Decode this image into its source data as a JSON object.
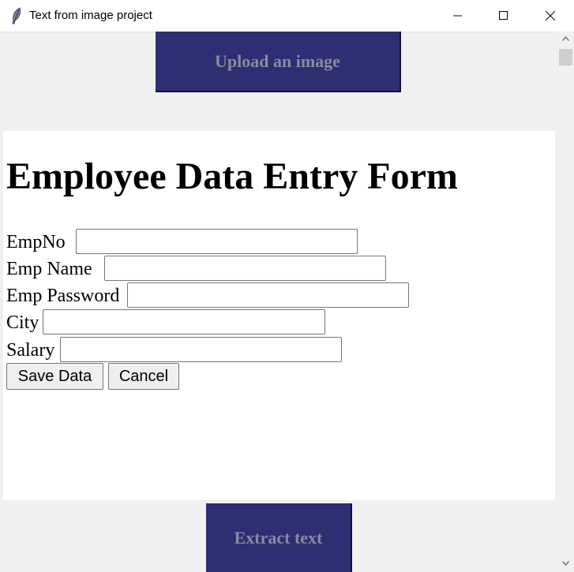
{
  "window": {
    "title": "Text from image project",
    "app_icon": "feather-icon",
    "controls": [
      "minimize-icon",
      "maximize-icon",
      "close-icon"
    ]
  },
  "upload_button": {
    "label": "Upload an image"
  },
  "form": {
    "title": "Employee Data Entry Form",
    "fields": [
      {
        "label": "EmpNo",
        "value": ""
      },
      {
        "label": "Emp Name",
        "value": ""
      },
      {
        "label": "Emp Password",
        "value": ""
      },
      {
        "label": "City",
        "value": ""
      },
      {
        "label": "Salary",
        "value": ""
      }
    ],
    "save_label": "Save Data",
    "cancel_label": "Cancel"
  },
  "extract_button": {
    "label": "Extract text"
  },
  "colors": {
    "button_bg": "#2e2e73",
    "button_text": "#8a8a9e",
    "window_bg": "#f0f0f0",
    "content_bg": "#ffffff"
  }
}
